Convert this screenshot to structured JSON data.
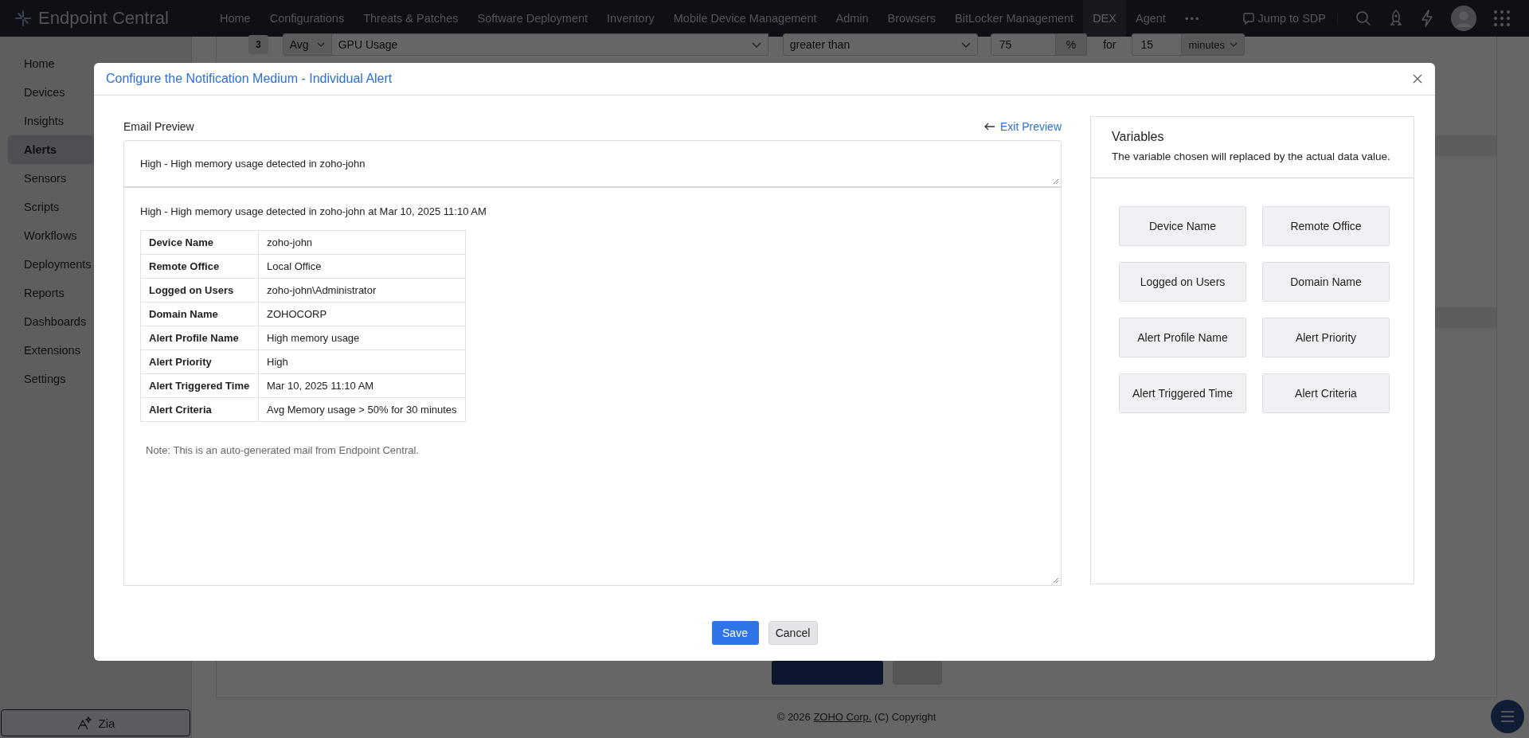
{
  "app": {
    "product_name": "Endpoint Central",
    "nav": [
      {
        "label": "Home",
        "selected": false
      },
      {
        "label": "Configurations",
        "selected": false
      },
      {
        "label": "Threats & Patches",
        "selected": false
      },
      {
        "label": "Software Deployment",
        "selected": false
      },
      {
        "label": "Inventory",
        "selected": false
      },
      {
        "label": "Mobile Device Management",
        "selected": false
      },
      {
        "label": "Admin",
        "selected": false
      },
      {
        "label": "Browsers",
        "selected": false
      },
      {
        "label": "BitLocker Management",
        "selected": false
      },
      {
        "label": "DEX",
        "selected": true
      },
      {
        "label": "Agent",
        "selected": false
      }
    ],
    "nav_more": "•••",
    "jump_to": "Jump to SDP"
  },
  "sidebar": {
    "items": [
      {
        "label": "Home",
        "selected": false
      },
      {
        "label": "Devices",
        "selected": false
      },
      {
        "label": "Insights",
        "selected": false
      },
      {
        "label": "Alerts",
        "selected": true
      },
      {
        "label": "Sensors",
        "selected": false
      },
      {
        "label": "Scripts",
        "selected": false
      },
      {
        "label": "Workflows",
        "selected": false
      },
      {
        "label": "Deployments",
        "selected": false
      },
      {
        "label": "Reports",
        "selected": false
      },
      {
        "label": "Dashboards",
        "selected": false
      },
      {
        "label": "Extensions",
        "selected": false
      },
      {
        "label": "Settings",
        "selected": false
      }
    ],
    "zia": "Zia"
  },
  "criteria_row": {
    "index": "3",
    "aggregate": "Avg",
    "metric": "GPU Usage",
    "operator": "greater than",
    "threshold": "75",
    "unit": "%",
    "for_label": "for",
    "duration": "15",
    "duration_unit": "minutes"
  },
  "footer": {
    "prefix": "© 2026",
    "link": "ZOHO Corp.",
    "suffix": "(C) Copyright"
  },
  "dialog": {
    "title": "Configure the Notification Medium - Individual Alert",
    "preview_label": "Email Preview",
    "exit_preview": "Exit Preview",
    "subject": "High - High memory usage detected in zoho-john",
    "body_intro": "High - High memory usage detected in zoho-john at Mar 10, 2025 11:10 AM",
    "details": [
      {
        "label": "Device Name",
        "value": "zoho-john"
      },
      {
        "label": "Remote Office",
        "value": "Local Office"
      },
      {
        "label": "Logged on Users",
        "value": "zoho-john\\Administrator"
      },
      {
        "label": "Domain Name",
        "value": "ZOHOCORP"
      },
      {
        "label": "Alert Profile Name",
        "value": "High memory usage"
      },
      {
        "label": "Alert Priority",
        "value": "High"
      },
      {
        "label": "Alert Triggered Time",
        "value": "Mar 10, 2025 11:10 AM"
      },
      {
        "label": "Alert Criteria",
        "value": "Avg Memory usage > 50% for 30 minutes"
      }
    ],
    "note": "Note: This is an auto-generated mail from Endpoint Central.",
    "variables": {
      "title": "Variables",
      "description": "The variable chosen will replaced by the actual data value.",
      "items": [
        "Device Name",
        "Remote Office",
        "Logged on Users",
        "Domain Name",
        "Alert Profile Name",
        "Alert Priority",
        "Alert Triggered Time",
        "Alert Criteria"
      ]
    },
    "buttons": {
      "save": "Save",
      "cancel": "Cancel"
    }
  }
}
